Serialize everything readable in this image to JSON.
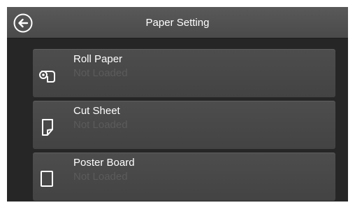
{
  "header": {
    "title": "Paper Setting",
    "back_icon": "back-arrow-icon"
  },
  "paper_sources": [
    {
      "label": "Roll Paper",
      "status": "Not Loaded",
      "icon": "roll-paper-icon"
    },
    {
      "label": "Cut Sheet",
      "status": "Not Loaded",
      "icon": "cut-sheet-icon"
    },
    {
      "label": "Poster Board",
      "status": "Not Loaded",
      "icon": "poster-board-icon"
    }
  ],
  "colors": {
    "screen_background": "#262626",
    "header_background": "#555555",
    "item_background": "#484848",
    "label_text": "#ffffff",
    "status_text": "#5b5b5b"
  }
}
